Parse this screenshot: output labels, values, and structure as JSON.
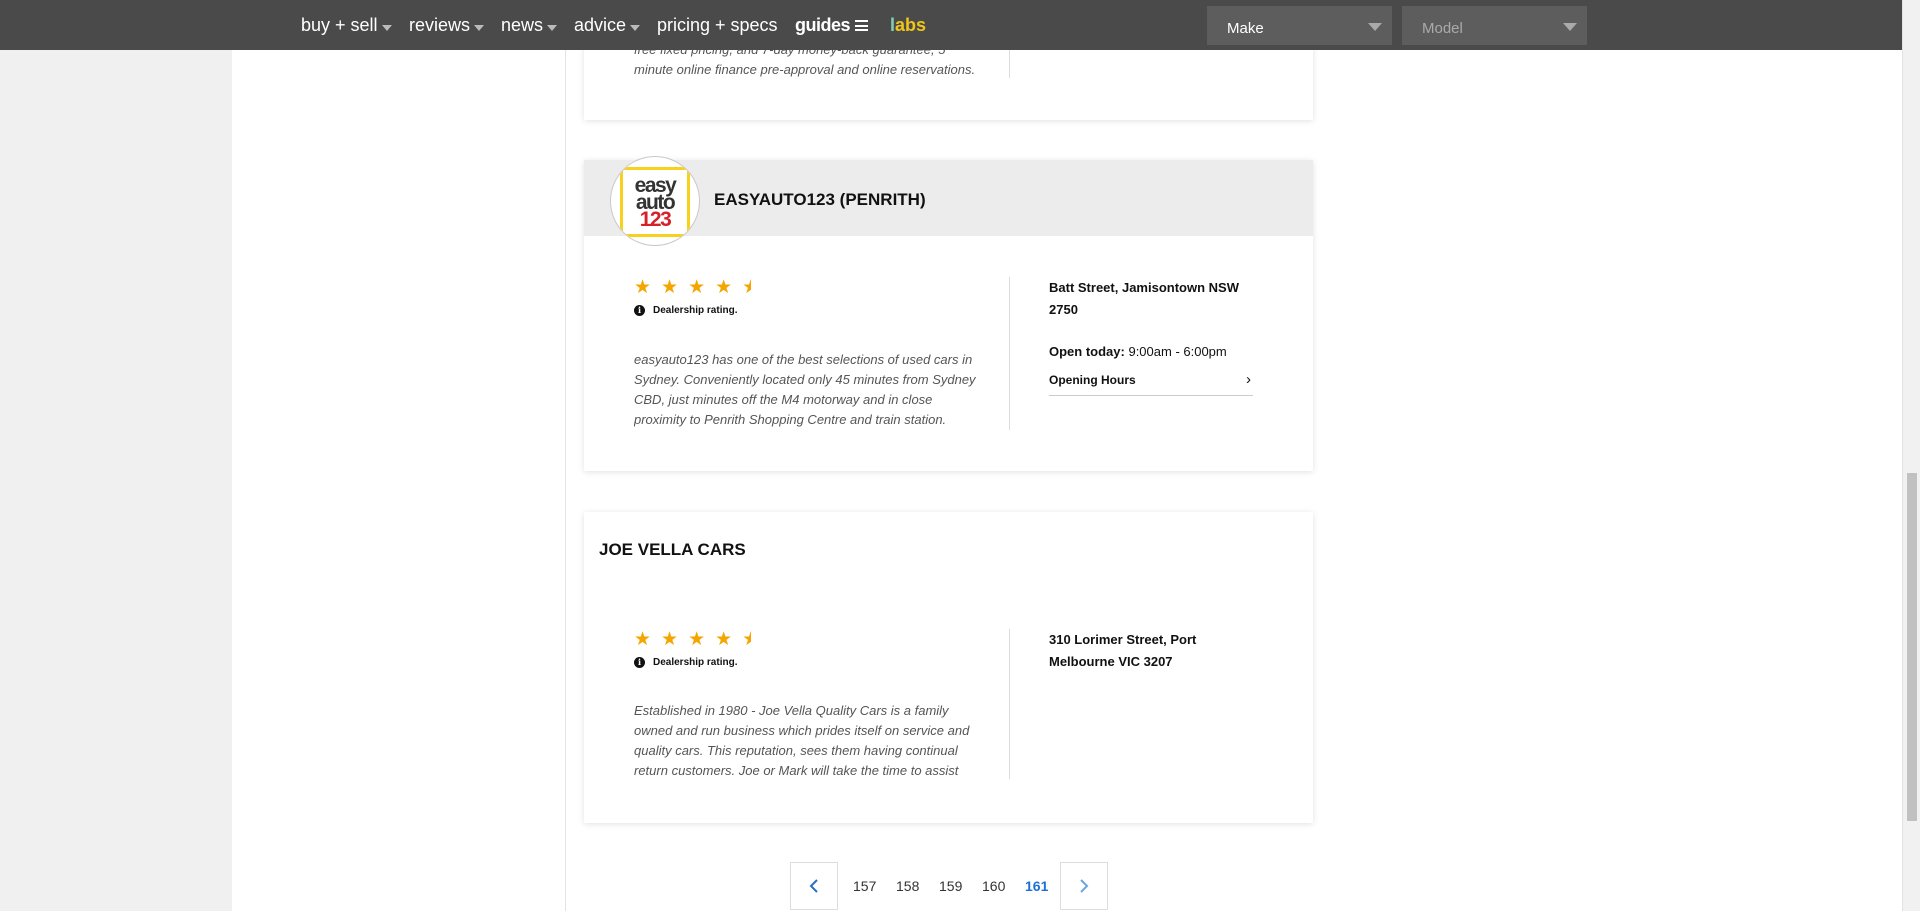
{
  "nav": {
    "items": [
      {
        "label": "buy + sell",
        "dropdown": true
      },
      {
        "label": "reviews",
        "dropdown": true
      },
      {
        "label": "news",
        "dropdown": true
      },
      {
        "label": "advice",
        "dropdown": true
      },
      {
        "label": "pricing + specs",
        "dropdown": false
      }
    ],
    "guides_label": "guides",
    "labs_l": "l",
    "labs_abs": "abs",
    "make_placeholder": "Make",
    "model_placeholder": "Model"
  },
  "top_card_partial": {
    "desc_line1": "free fixed pricing, and 7-day money-back guarantee, 5",
    "desc_line2": "minute online finance pre-approval and online reservations."
  },
  "dealers": [
    {
      "name": "EASYAUTO123 (PENRITH)",
      "logo_text": [
        "easy",
        "auto",
        "123"
      ],
      "rating_stars": 4.5,
      "rating_label": "Dealership rating.",
      "description": "easyauto123 has one of the best selections of used cars in Sydney. Conveniently located only 45 minutes from Sydney CBD, just minutes off the M4 motorway and in close proximity to Penrith Shopping Centre and train station.",
      "address": "Batt Street, Jamisontown NSW 2750",
      "open_label": "Open today:",
      "open_hours": "9:00am - 6:00pm",
      "hours_link": "Opening Hours"
    },
    {
      "name": "JOE VELLA CARS",
      "rating_stars": 4.5,
      "rating_label": "Dealership rating.",
      "description": "Established in 1980 - Joe Vella Quality Cars is a family owned and run business which prides itself on service and quality cars. This reputation, sees them having continual return customers. Joe or Mark will take the time to assist",
      "address": "310 Lorimer Street, Port Melbourne VIC 3207"
    }
  ],
  "pagination": {
    "pages": [
      "157",
      "158",
      "159",
      "160",
      "161"
    ],
    "active": "161",
    "prev_icon": "chevron-left-icon",
    "next_icon": "chevron-right-icon"
  },
  "colors": {
    "nav_bg": "#4a4a4a",
    "star": "#f5a500",
    "active_page": "#1d6fd6"
  }
}
